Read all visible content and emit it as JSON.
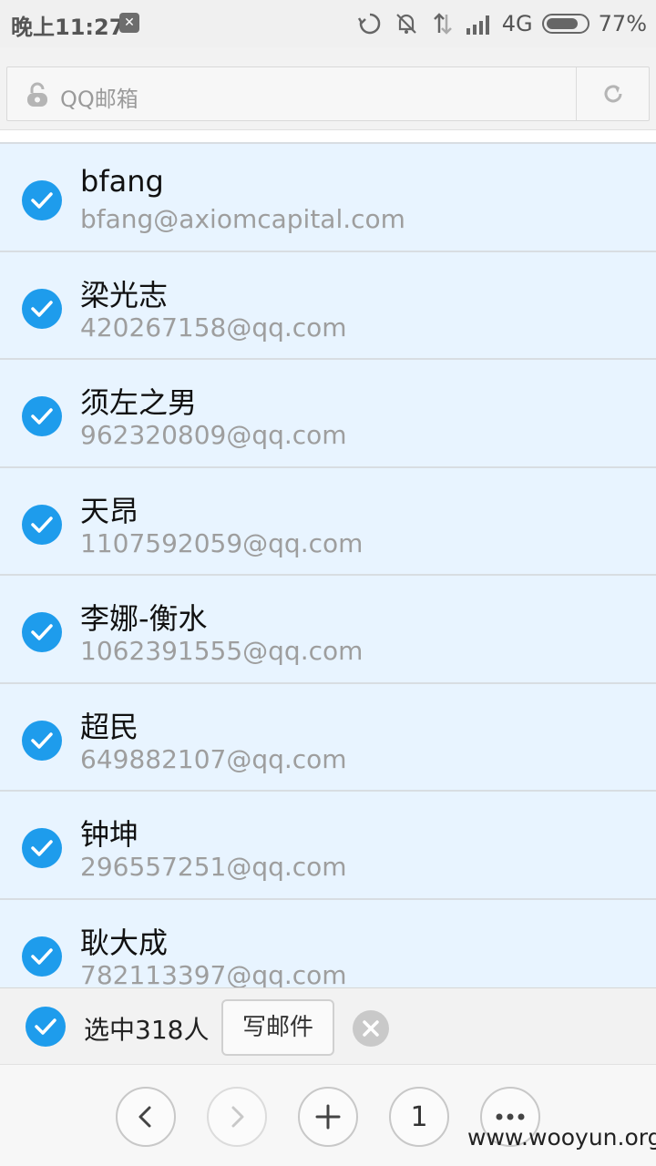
{
  "status_bar": {
    "time": "晚上11:27",
    "network": "4G",
    "battery_text": "77%",
    "battery_level": 0.77,
    "app_icon": "app-notification-icon"
  },
  "address_bar": {
    "title": "QQ邮箱",
    "lock_icon": "lock-icon",
    "reload_icon": "reload-icon"
  },
  "contacts": [
    {
      "name": "bfang",
      "email": "bfang@axiomcapital.com"
    },
    {
      "name": "梁光志",
      "email": "420267158@qq.com"
    },
    {
      "name": "须左之男",
      "email": "962320809@qq.com"
    },
    {
      "name": "天昂",
      "email": "1107592059@qq.com"
    },
    {
      "name": "李娜-衡水",
      "email": "1062391555@qq.com"
    },
    {
      "name": "超民",
      "email": "649882107@qq.com"
    },
    {
      "name": "钟坤",
      "email": "296557251@qq.com"
    },
    {
      "name": "耿大成",
      "email": "782113397@qq.com"
    }
  ],
  "selection": {
    "text": "选中318人",
    "write_mail_label": "写邮件"
  },
  "bottom_nav": {
    "tab_count": "1"
  },
  "watermark": "www.wooyun.org",
  "colors": {
    "accent": "#1e9cec",
    "row_background": "#e8f4ff"
  }
}
